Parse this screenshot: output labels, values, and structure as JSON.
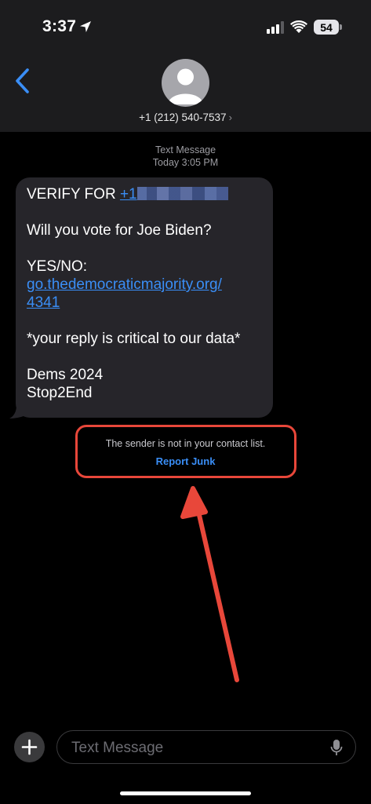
{
  "status_bar": {
    "time": "3:37",
    "battery": "54"
  },
  "header": {
    "contact": "+1 (212) 540-7537",
    "chevron": "›"
  },
  "timestamp": {
    "label": "Text Message",
    "time": "Today 3:05 PM"
  },
  "message": {
    "line1_prefix": "VERIFY FOR ",
    "line1_link": "+1",
    "question": "Will you vote for Joe Biden?",
    "yes_no": "YES/NO:",
    "link_part1": "go.thedemocraticmajority.org/",
    "link_part2": "4341",
    "critical": "*your reply is critical to our data*",
    "sign1": "Dems 2024",
    "sign2": "Stop2End"
  },
  "junk_notice": {
    "text": "The sender is not in your contact list.",
    "action": "Report Junk"
  },
  "composer": {
    "placeholder": "Text Message"
  },
  "colors": {
    "accent": "#3a8ef6",
    "highlight": "#e8473a",
    "bubble": "#26252a",
    "header": "#1c1c1e"
  },
  "icons": [
    "location-arrow-icon",
    "signal-icon",
    "wifi-icon",
    "back-chevron-icon",
    "person-icon",
    "plus-icon",
    "mic-icon"
  ]
}
